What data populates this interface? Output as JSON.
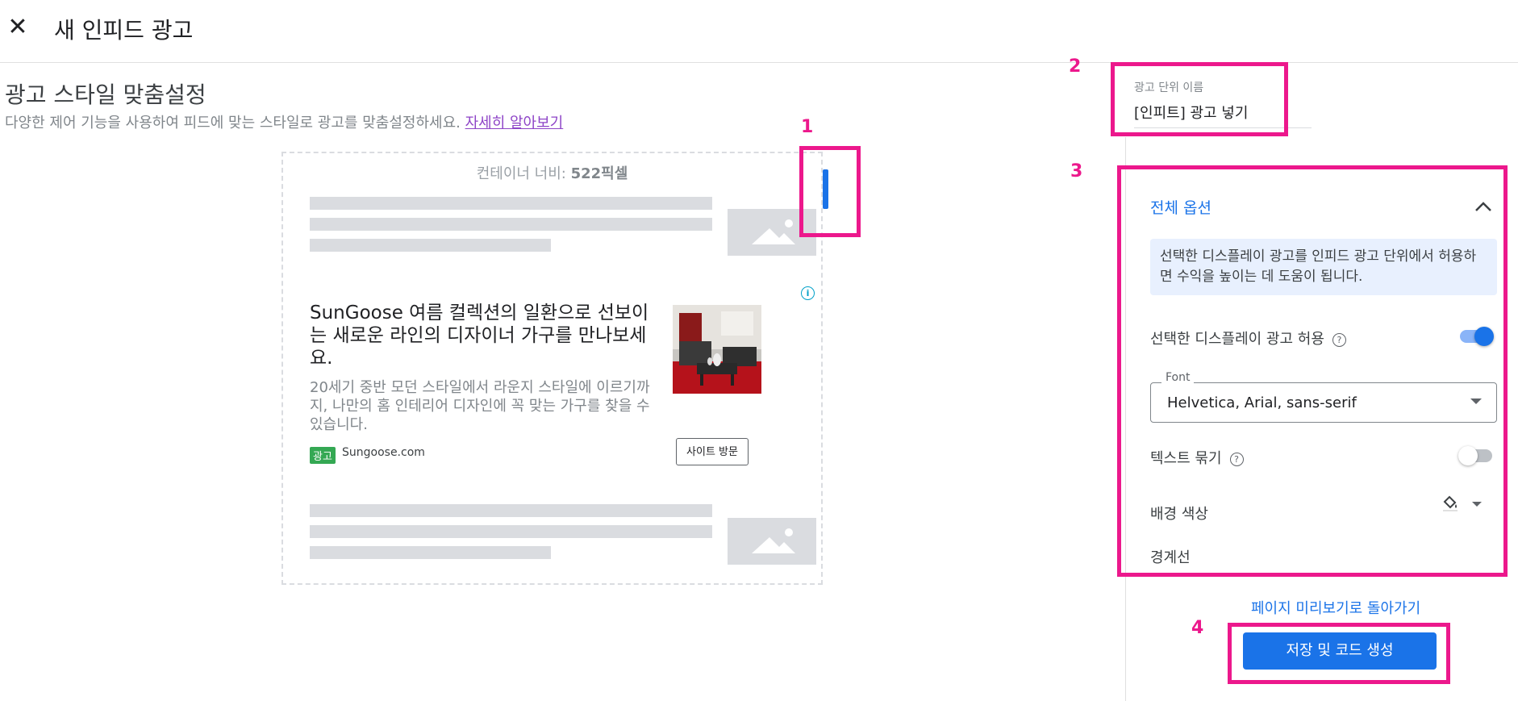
{
  "header": {
    "close_icon": "close-icon",
    "title": "새 인피드 광고"
  },
  "customize": {
    "title": "광고 스타일 맞춤설정",
    "description": "다양한 제어 기능을 사용하여 피드에 맞는 스타일로 광고를 맞춤설정하세요.",
    "learn_more": "자세히 알아보기"
  },
  "preview": {
    "container_width_label": "컨테이너 너비:",
    "container_width_value": "522픽셀",
    "ad": {
      "headline": "SunGoose 여름 컬렉션의 일환으로 선보이는 새로운 라인의 디자이너 가구를 만나보세요.",
      "body": "20세기 중반 모던 스타일에서 라운지 스타일에 이르기까지, 나만의 홈 인테리어 디자인에 꼭 맞는 가구를 찾을 수 있습니다.",
      "badge": "광고",
      "domain": "Sungoose.com",
      "cta": "사이트 방문"
    }
  },
  "annotations": {
    "n1": "1",
    "n2": "2",
    "n3": "3",
    "n4": "4",
    "color": "#ec188c"
  },
  "ad_unit": {
    "label": "광고 단위 이름",
    "value": "[인피트] 광고 넣기"
  },
  "options": {
    "section_title": "전체 옵션",
    "info_text": "선택한 디스플레이 광고를 인피드 광고 단위에서 허용하면 수익을 높이는 데 도움이 됩니다.",
    "allow_display_label": "선택한 디스플레이 광고 허용",
    "allow_display_on": true,
    "font_legend": "Font",
    "font_value": "Helvetica, Arial, sans-serif",
    "text_wrap_label": "텍스트 묶기",
    "text_wrap_on": false,
    "bg_color_label": "배경 색상",
    "border_label": "경계선"
  },
  "footer": {
    "back_link": "페이지 미리보기로 돌아가기",
    "save_button": "저장 및 코드 생성"
  },
  "colors": {
    "accent": "#1a73e8",
    "annotation": "#ec188c",
    "placeholder": "#dadce0"
  }
}
